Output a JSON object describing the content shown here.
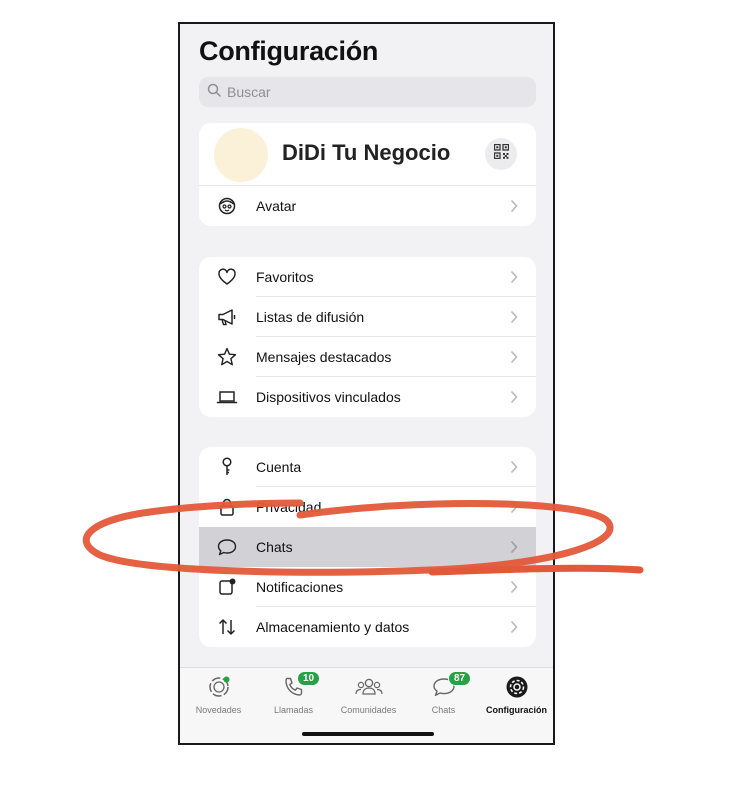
{
  "page": {
    "title": "Configuración"
  },
  "search": {
    "placeholder": "Buscar"
  },
  "profile": {
    "name": "DiDi Tu Negocio",
    "qr_icon": "qr-code-icon"
  },
  "group1": [
    {
      "id": "avatar",
      "label": "Avatar",
      "icon": "avatar-face-icon"
    }
  ],
  "group2": [
    {
      "id": "favoritos",
      "label": "Favoritos",
      "icon": "heart-icon"
    },
    {
      "id": "listas",
      "label": "Listas de difusión",
      "icon": "megaphone-icon"
    },
    {
      "id": "destacados",
      "label": "Mensajes destacados",
      "icon": "star-icon"
    },
    {
      "id": "dispositivos",
      "label": "Dispositivos vinculados",
      "icon": "laptop-icon"
    }
  ],
  "group3": [
    {
      "id": "cuenta",
      "label": "Cuenta",
      "icon": "key-icon"
    },
    {
      "id": "privacidad",
      "label": "Privacidad",
      "icon": "lock-icon"
    },
    {
      "id": "chats",
      "label": "Chats",
      "icon": "chat-bubble-icon",
      "highlighted": true
    },
    {
      "id": "notificaciones",
      "label": "Notificaciones",
      "icon": "bell-icon"
    },
    {
      "id": "almacenamiento",
      "label": "Almacenamiento y datos",
      "icon": "up-down-arrows-icon"
    }
  ],
  "tabbar": {
    "tabs": [
      {
        "id": "novedades",
        "label": "Novedades",
        "icon": "status-ring-icon"
      },
      {
        "id": "llamadas",
        "label": "Llamadas",
        "icon": "phone-icon",
        "badge": "10"
      },
      {
        "id": "comunidades",
        "label": "Comunidades",
        "icon": "people-icon"
      },
      {
        "id": "chats",
        "label": "Chats",
        "icon": "chat-bubble-icon",
        "badge": "87"
      },
      {
        "id": "configuracion",
        "label": "Configuración",
        "icon": "gear-icon",
        "active": true
      }
    ]
  },
  "colors": {
    "badge": "#25a244",
    "highlight_row": "#d1d1d6",
    "annotation": "#e4583a",
    "avatar_bg": "#fbf1d9"
  }
}
